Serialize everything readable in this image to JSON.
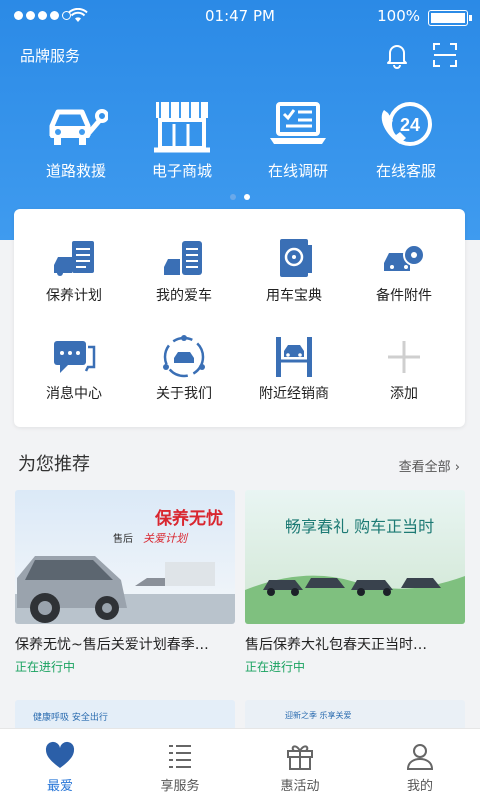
{
  "status": {
    "time": "01:47 PM",
    "battery": "100%"
  },
  "header": {
    "brand": "品牌服务"
  },
  "quick": [
    "道路救援",
    "电子商城",
    "在线调研",
    "在线客服"
  ],
  "quick_badge": "24",
  "grid": [
    "保养计划",
    "我的爱车",
    "用车宝典",
    "备件附件",
    "消息中心",
    "关于我们",
    "附近经销商",
    "添加"
  ],
  "section": {
    "title": "为您推荐",
    "more": "查看全部"
  },
  "recs": [
    {
      "title": "保养无忧~售后关爱计划春季…",
      "status": "正在进行中",
      "banner_a": "保养无忧",
      "banner_b": "售后",
      "banner_c": "关爱计划"
    },
    {
      "title": "售后保养大礼包春天正当时…",
      "status": "正在进行中",
      "banner": "畅享春礼 购车正当时"
    }
  ],
  "peek": [
    "健康呼吸 安全出行",
    "迎新之季 乐享关爱 "
  ],
  "tabs": [
    "最爱",
    "享服务",
    "惠活动",
    "我的"
  ],
  "colors": {
    "primary": "#2b8ae6",
    "accent": "#2b78d8",
    "status_green": "#1aa260",
    "icon_blue": "#3a6fb5"
  }
}
